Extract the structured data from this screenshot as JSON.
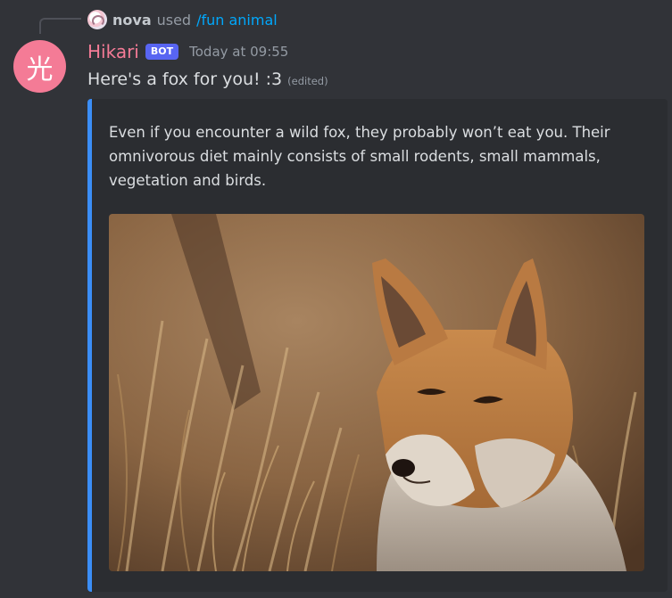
{
  "reply": {
    "user": "nova",
    "used": "used",
    "command": "/fun animal"
  },
  "author": {
    "avatar_glyph": "光",
    "name": "Hikari",
    "badge": "BOT",
    "timestamp": "Today at 09:55",
    "name_color": "#f47b96"
  },
  "message": {
    "text": "Here's a fox for you! :3",
    "edited": "(edited)"
  },
  "embed": {
    "accent_color": "#3b8ef7",
    "description": "Even if you encounter a wild fox, they probably won’t eat you. Their omnivorous diet mainly consists of small rodents, small mammals, vegetation and birds.",
    "image_subject": "red fox sitting in dry golden grass"
  }
}
